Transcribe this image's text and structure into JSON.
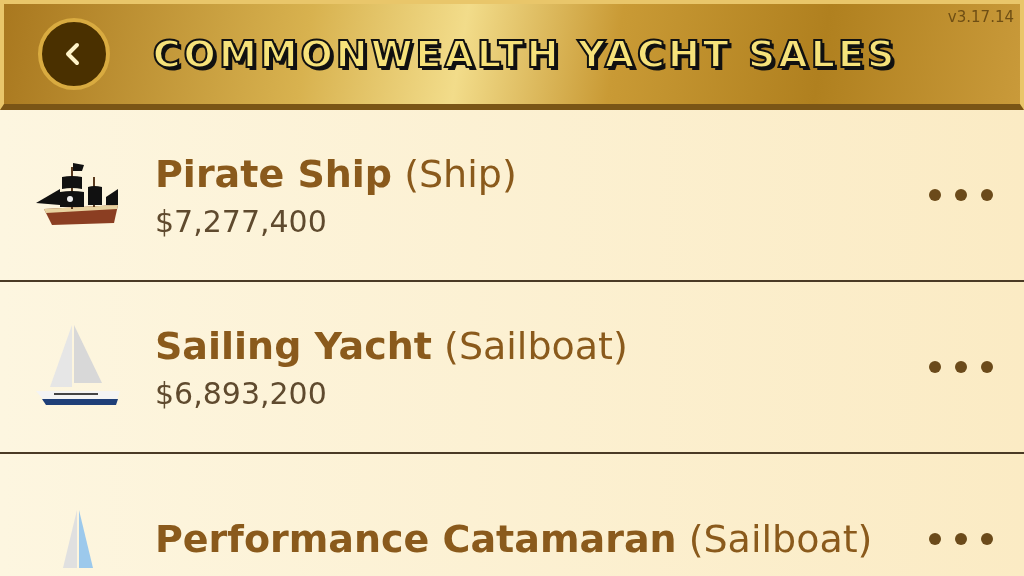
{
  "header": {
    "title": "COMMONWEALTH YACHT SALES",
    "version": "v3.17.14"
  },
  "items": [
    {
      "kind": "pirate",
      "name": "Pirate Ship",
      "type": "(Ship)",
      "price": "$7,277,400"
    },
    {
      "kind": "sailboat",
      "name": "Sailing Yacht",
      "type": "(Sailboat)",
      "price": "$6,893,200"
    },
    {
      "kind": "catamaran",
      "name": "Performance Catamaran",
      "type": "(Sailboat)"
    }
  ]
}
